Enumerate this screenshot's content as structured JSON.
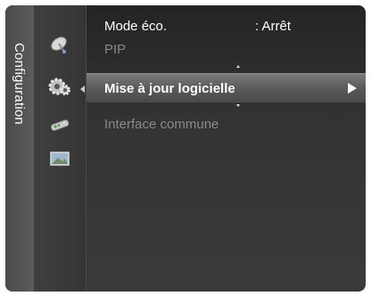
{
  "sidebar": {
    "title": "Configuration",
    "categories": [
      {
        "icon": "satellite-dish-icon"
      },
      {
        "icon": "gear-icon"
      },
      {
        "icon": "remote-control-icon"
      },
      {
        "icon": "picture-icon"
      }
    ]
  },
  "menu": {
    "items": [
      {
        "label": "Mode éco.",
        "value": ": Arrêt"
      },
      {
        "label": "PIP"
      },
      {
        "label": "Mise à jour logicielle"
      },
      {
        "label": "Interface commune"
      }
    ]
  },
  "colors": {
    "background": "#333333",
    "selected_row": "#6a6a6a",
    "text_active": "#ffffff",
    "text_disabled": "#8a8a8a"
  }
}
